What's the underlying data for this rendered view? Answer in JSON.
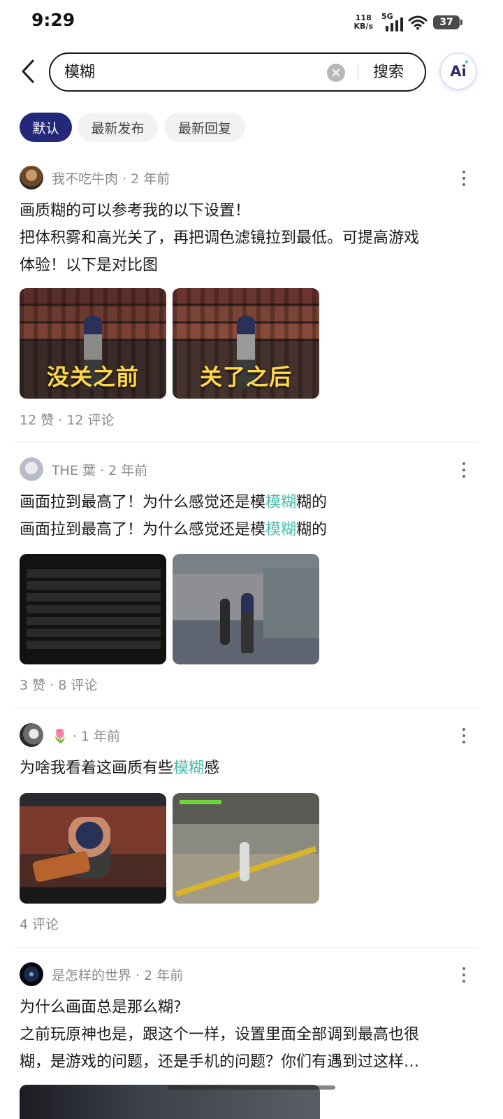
{
  "status_bar": {
    "time": "9:29",
    "net_speed_value": "118",
    "net_speed_unit": "KB/s",
    "network_type": "5G",
    "battery": "37"
  },
  "search": {
    "query": "模糊",
    "submit_label": "搜索",
    "ai_label": "Ai"
  },
  "sort_tabs": [
    {
      "label": "默认",
      "active": true
    },
    {
      "label": "最新发布",
      "active": false
    },
    {
      "label": "最新回复",
      "active": false
    }
  ],
  "posts": [
    {
      "author": "我不吃牛肉",
      "time": "2 年前",
      "lines": [
        "画质糊的可以参考我的以下设置！",
        "把体积雾和高光关了，再把调色滤镜拉到最低。可提高游戏",
        "体验！以下是对比图"
      ],
      "image_captions": [
        "没关之前",
        "关了之后"
      ],
      "stats": "12 赞 · 12 评论"
    },
    {
      "author": "THE 葉",
      "time": "2 年前",
      "line_parts": [
        [
          "画面拉到最高了！为什么感觉还是模",
          "模糊",
          "糊的"
        ],
        [
          "画面拉到最高了！为什么感觉还是模",
          "模糊",
          "糊的"
        ]
      ],
      "stats": "3 赞 · 8 评论"
    },
    {
      "author": "🌷",
      "time": "1 年前",
      "line_parts": [
        [
          "为啥我看着这画质有些",
          "模糊",
          "感"
        ]
      ],
      "stats": "4 评论"
    },
    {
      "author": "是怎样的世界",
      "time": "2 年前",
      "lines": [
        "为什么画面总是那么糊?",
        "之前玩原神也是，跟这个一样，设置里面全部调到最高也很",
        "糊，是游戏的问题，还是手机的问题？你们有遇到过这样…"
      ]
    }
  ],
  "colors": {
    "accent_pill": "#23287a",
    "highlight": "#48bfae",
    "meta_gray": "#8a8a8a"
  }
}
